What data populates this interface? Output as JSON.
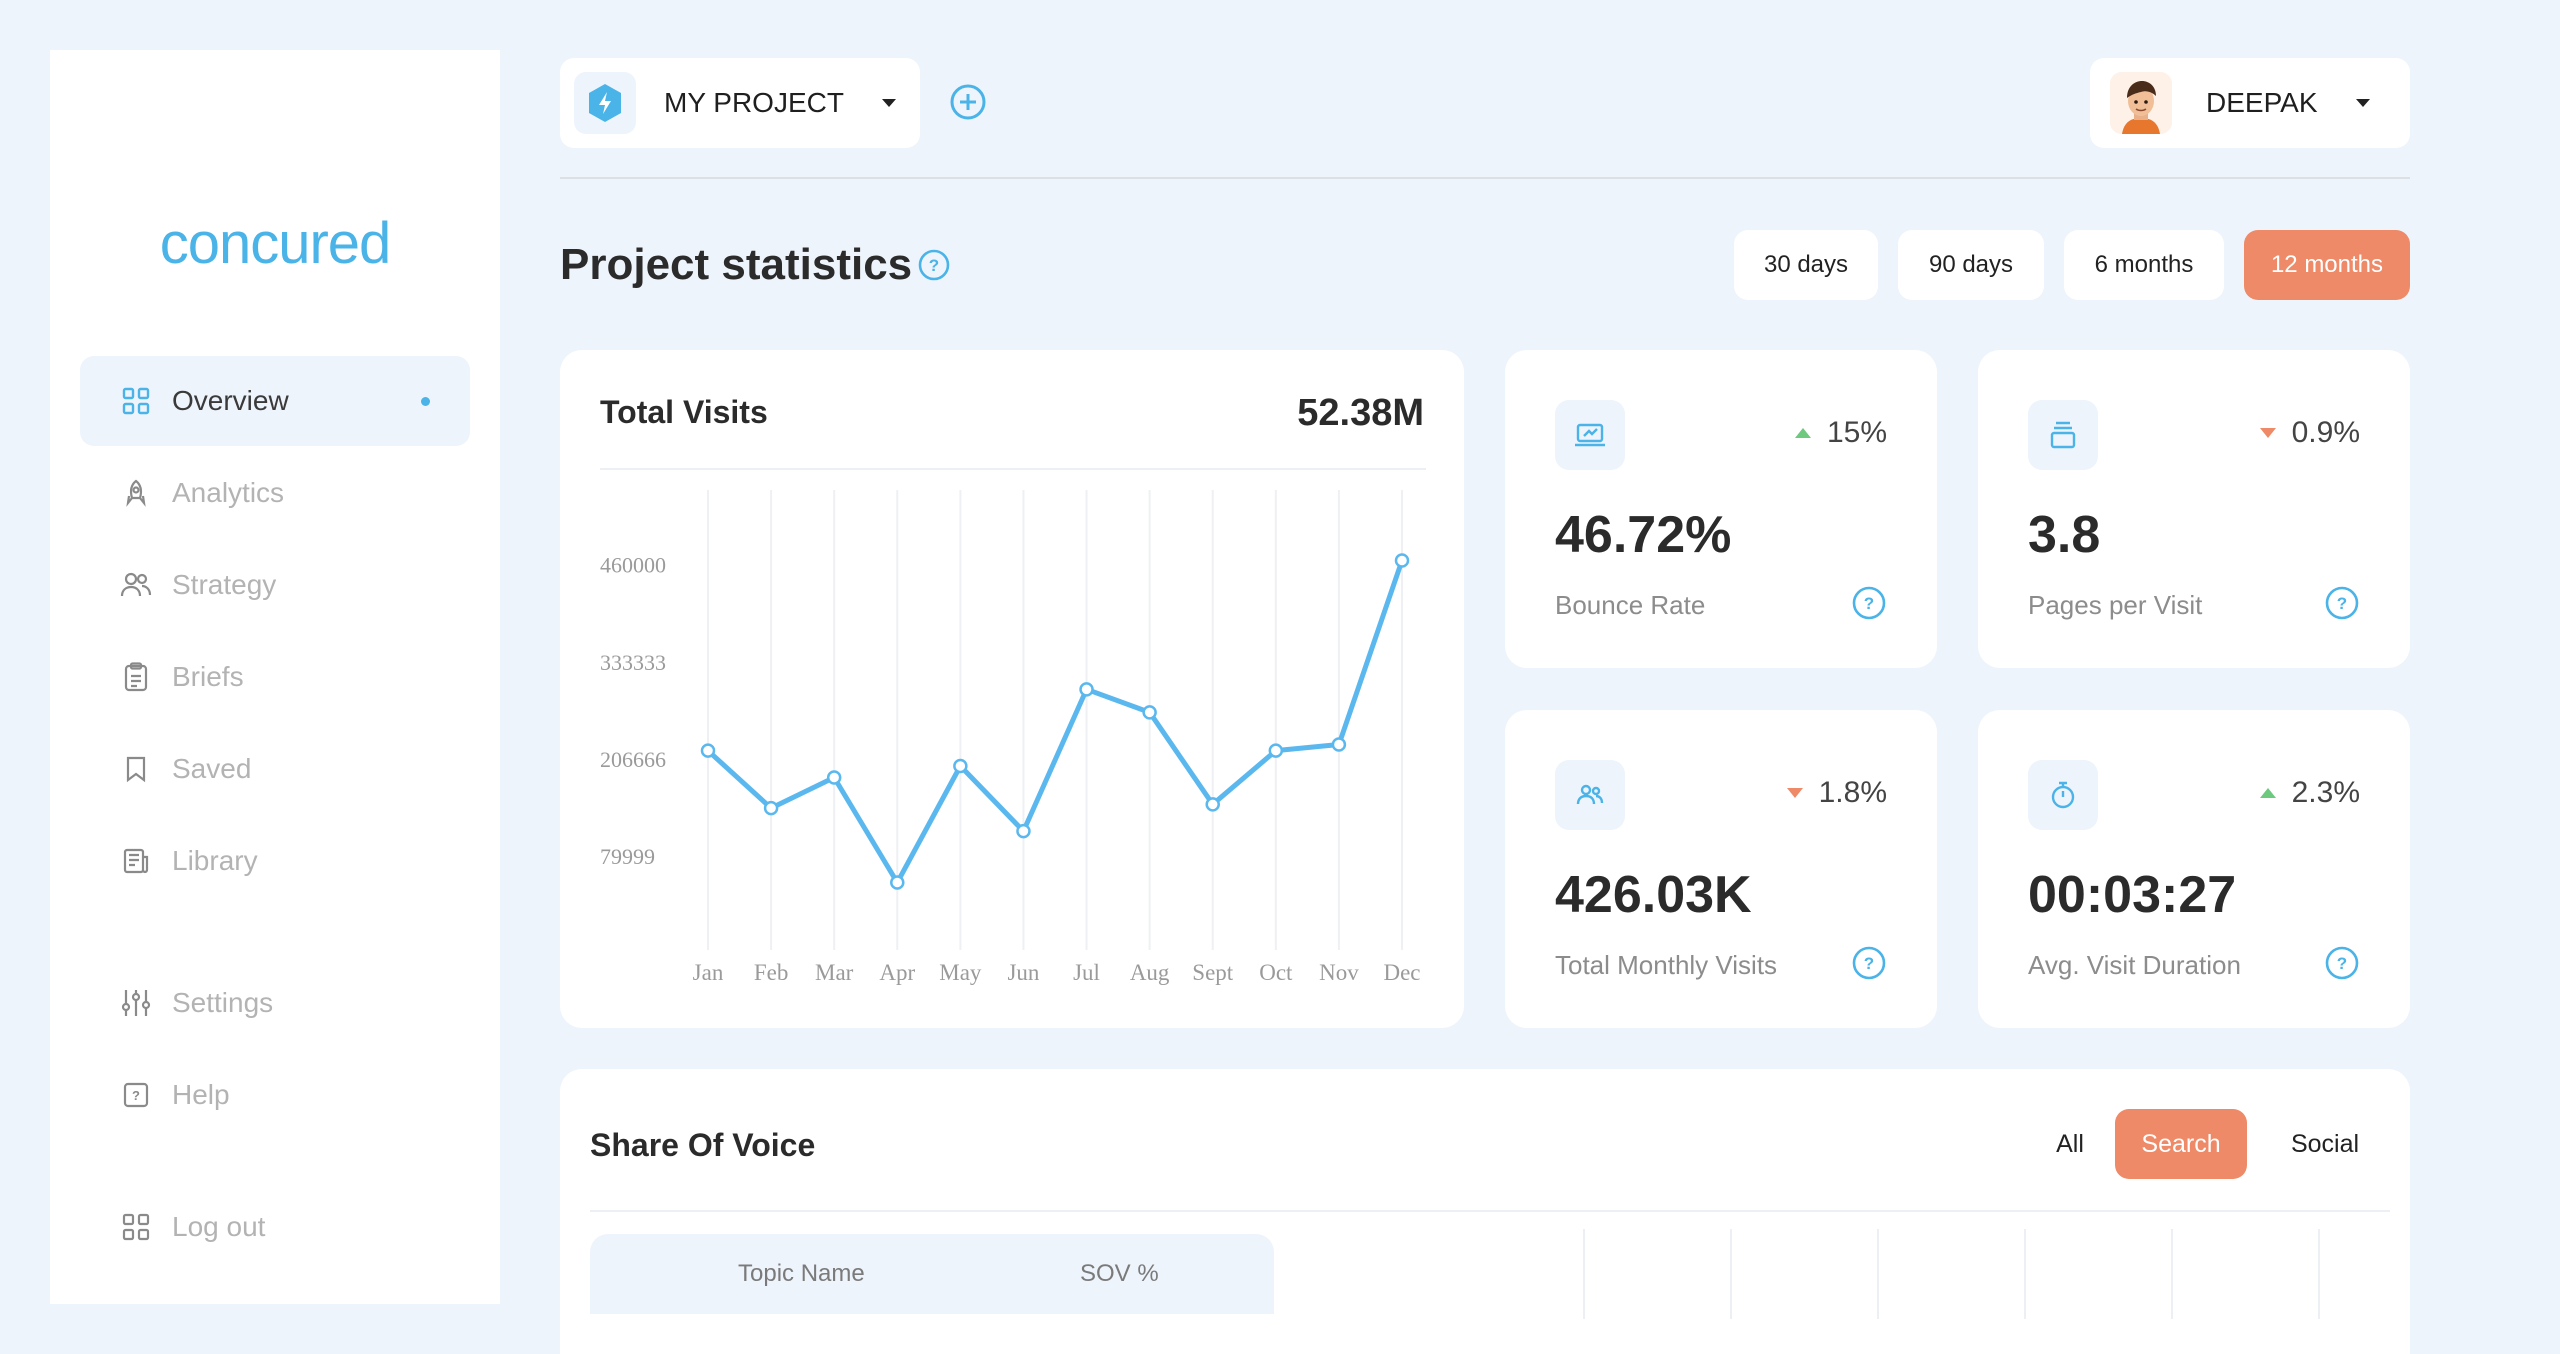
{
  "brand": {
    "logo": "concured"
  },
  "sidebar": {
    "items": [
      {
        "label": "Overview",
        "icon": "grid-icon",
        "active": true
      },
      {
        "label": "Analytics",
        "icon": "rocket-icon"
      },
      {
        "label": "Strategy",
        "icon": "users-icon"
      },
      {
        "label": "Briefs",
        "icon": "clipboard-icon"
      },
      {
        "label": "Saved",
        "icon": "bookmark-icon"
      },
      {
        "label": "Library",
        "icon": "newspaper-icon"
      }
    ],
    "bottom": [
      {
        "label": "Settings",
        "icon": "sliders-icon"
      },
      {
        "label": "Help",
        "icon": "help-square-icon"
      },
      {
        "label": "Log out",
        "icon": "grid-icon"
      }
    ]
  },
  "topbar": {
    "project": "MY PROJECT",
    "user": "DEEPAK"
  },
  "header": {
    "title": "Project statistics",
    "ranges": [
      "30 days",
      "90 days",
      "6 months",
      "12 months"
    ],
    "active_range": "12 months"
  },
  "visits": {
    "title": "Total Visits",
    "total": "52.38M"
  },
  "stats": [
    {
      "value": "46.72%",
      "label": "Bounce Rate",
      "change": "15%",
      "direction": "up",
      "icon": "laptop-chart-icon"
    },
    {
      "value": "3.8",
      "label": "Pages per Visit",
      "change": "0.9%",
      "direction": "down",
      "icon": "stack-icon"
    },
    {
      "value": "426.03K",
      "label": "Total Monthly Visits",
      "change": "1.8%",
      "direction": "down",
      "icon": "users-icon"
    },
    {
      "value": "00:03:27",
      "label": "Avg. Visit Duration",
      "change": "2.3%",
      "direction": "up",
      "icon": "stopwatch-icon"
    }
  ],
  "sov": {
    "title": "Share Of Voice",
    "tabs": [
      "All",
      "Search",
      "Social"
    ],
    "active_tab": "Search",
    "columns": [
      "Topic Name",
      "SOV %"
    ]
  },
  "colors": {
    "accent": "#4ab3e8",
    "orange": "#ee8a67",
    "green": "#6cc97d",
    "background": "#eef4fc"
  },
  "chart_data": {
    "type": "line",
    "title": "",
    "categories": [
      "Jan",
      "Feb",
      "Mar",
      "Apr",
      "May",
      "Jun",
      "Jul",
      "Aug",
      "Sept",
      "Oct",
      "Nov",
      "Dec"
    ],
    "values": [
      220000,
      145000,
      185000,
      48000,
      200000,
      115000,
      300000,
      270000,
      150000,
      220000,
      228000,
      468000
    ],
    "ytick_labels": [
      "460000",
      "333333",
      "206666",
      "79999"
    ],
    "yticks": [
      460000,
      333333,
      206666,
      79999
    ],
    "ylim": [
      -40000,
      560000
    ],
    "grid": "vertical"
  }
}
